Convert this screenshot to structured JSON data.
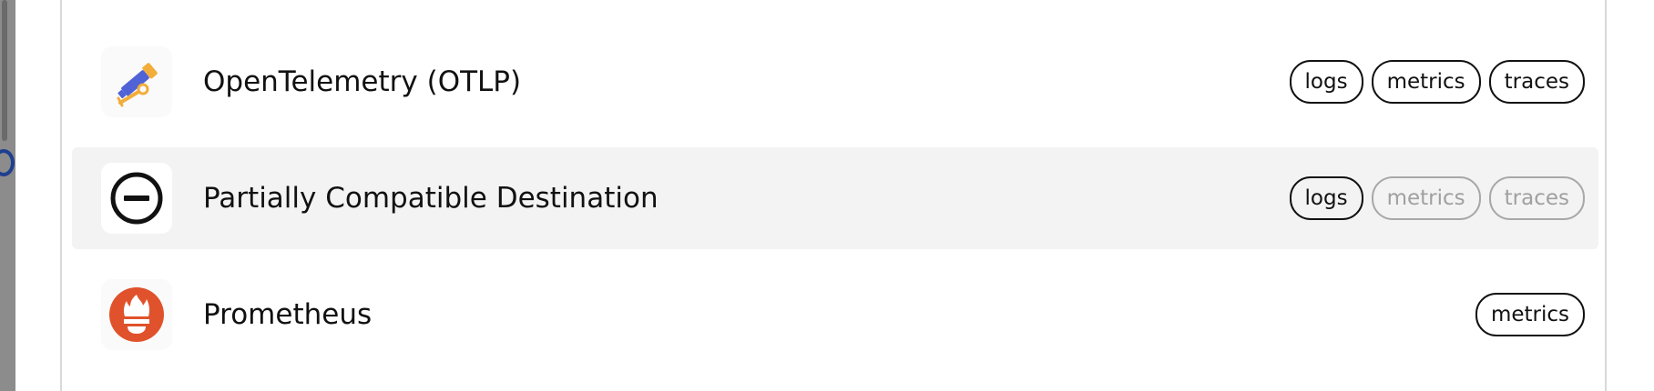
{
  "destinations": [
    {
      "name": "OpenTelemetry (OTLP)",
      "icon": "telescope-icon",
      "highlighted": false,
      "tags": [
        {
          "label": "logs",
          "enabled": true
        },
        {
          "label": "metrics",
          "enabled": true
        },
        {
          "label": "traces",
          "enabled": true
        }
      ]
    },
    {
      "name": "Partially Compatible Destination",
      "icon": "minus-circle-icon",
      "highlighted": true,
      "tags": [
        {
          "label": "logs",
          "enabled": true
        },
        {
          "label": "metrics",
          "enabled": false
        },
        {
          "label": "traces",
          "enabled": false
        }
      ]
    },
    {
      "name": "Prometheus",
      "icon": "prometheus-flame-icon",
      "highlighted": false,
      "tags": [
        {
          "label": "metrics",
          "enabled": true
        }
      ]
    }
  ],
  "colors": {
    "highlight_bg": "#f3f3f3",
    "tag_border": "#111111",
    "tag_dim": "#a8a8a8",
    "prometheus": "#e0522b",
    "otel_blue": "#4f62d6",
    "otel_yellow": "#f2ad3a"
  }
}
